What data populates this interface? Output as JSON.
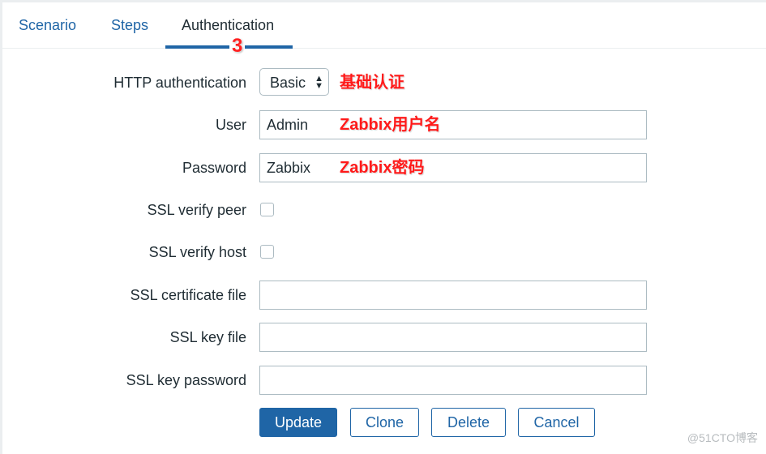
{
  "tabs": [
    {
      "label": "Scenario",
      "active": false
    },
    {
      "label": "Steps",
      "active": false
    },
    {
      "label": "Authentication",
      "active": true
    }
  ],
  "annotation_step": "3",
  "form": {
    "http_auth": {
      "label": "HTTP authentication",
      "value": "Basic",
      "annotation": "基础认证"
    },
    "user": {
      "label": "User",
      "value": "Admin",
      "annotation": "Zabbix用户名"
    },
    "password": {
      "label": "Password",
      "value": "Zabbix",
      "annotation": "Zabbix密码"
    },
    "ssl_verify_peer": {
      "label": "SSL verify peer",
      "checked": false
    },
    "ssl_verify_host": {
      "label": "SSL verify host",
      "checked": false
    },
    "ssl_cert_file": {
      "label": "SSL certificate file",
      "value": ""
    },
    "ssl_key_file": {
      "label": "SSL key file",
      "value": ""
    },
    "ssl_key_password": {
      "label": "SSL key password",
      "value": ""
    }
  },
  "buttons": {
    "update": "Update",
    "clone": "Clone",
    "delete": "Delete",
    "cancel": "Cancel"
  },
  "icons": {
    "select_arrows": "▲▼"
  },
  "watermark": "@51CTO博客",
  "colors": {
    "accent": "#1f65a6",
    "text": "#1f2c33",
    "annotation": "#ff1a1a",
    "border": "#acbbc2"
  }
}
